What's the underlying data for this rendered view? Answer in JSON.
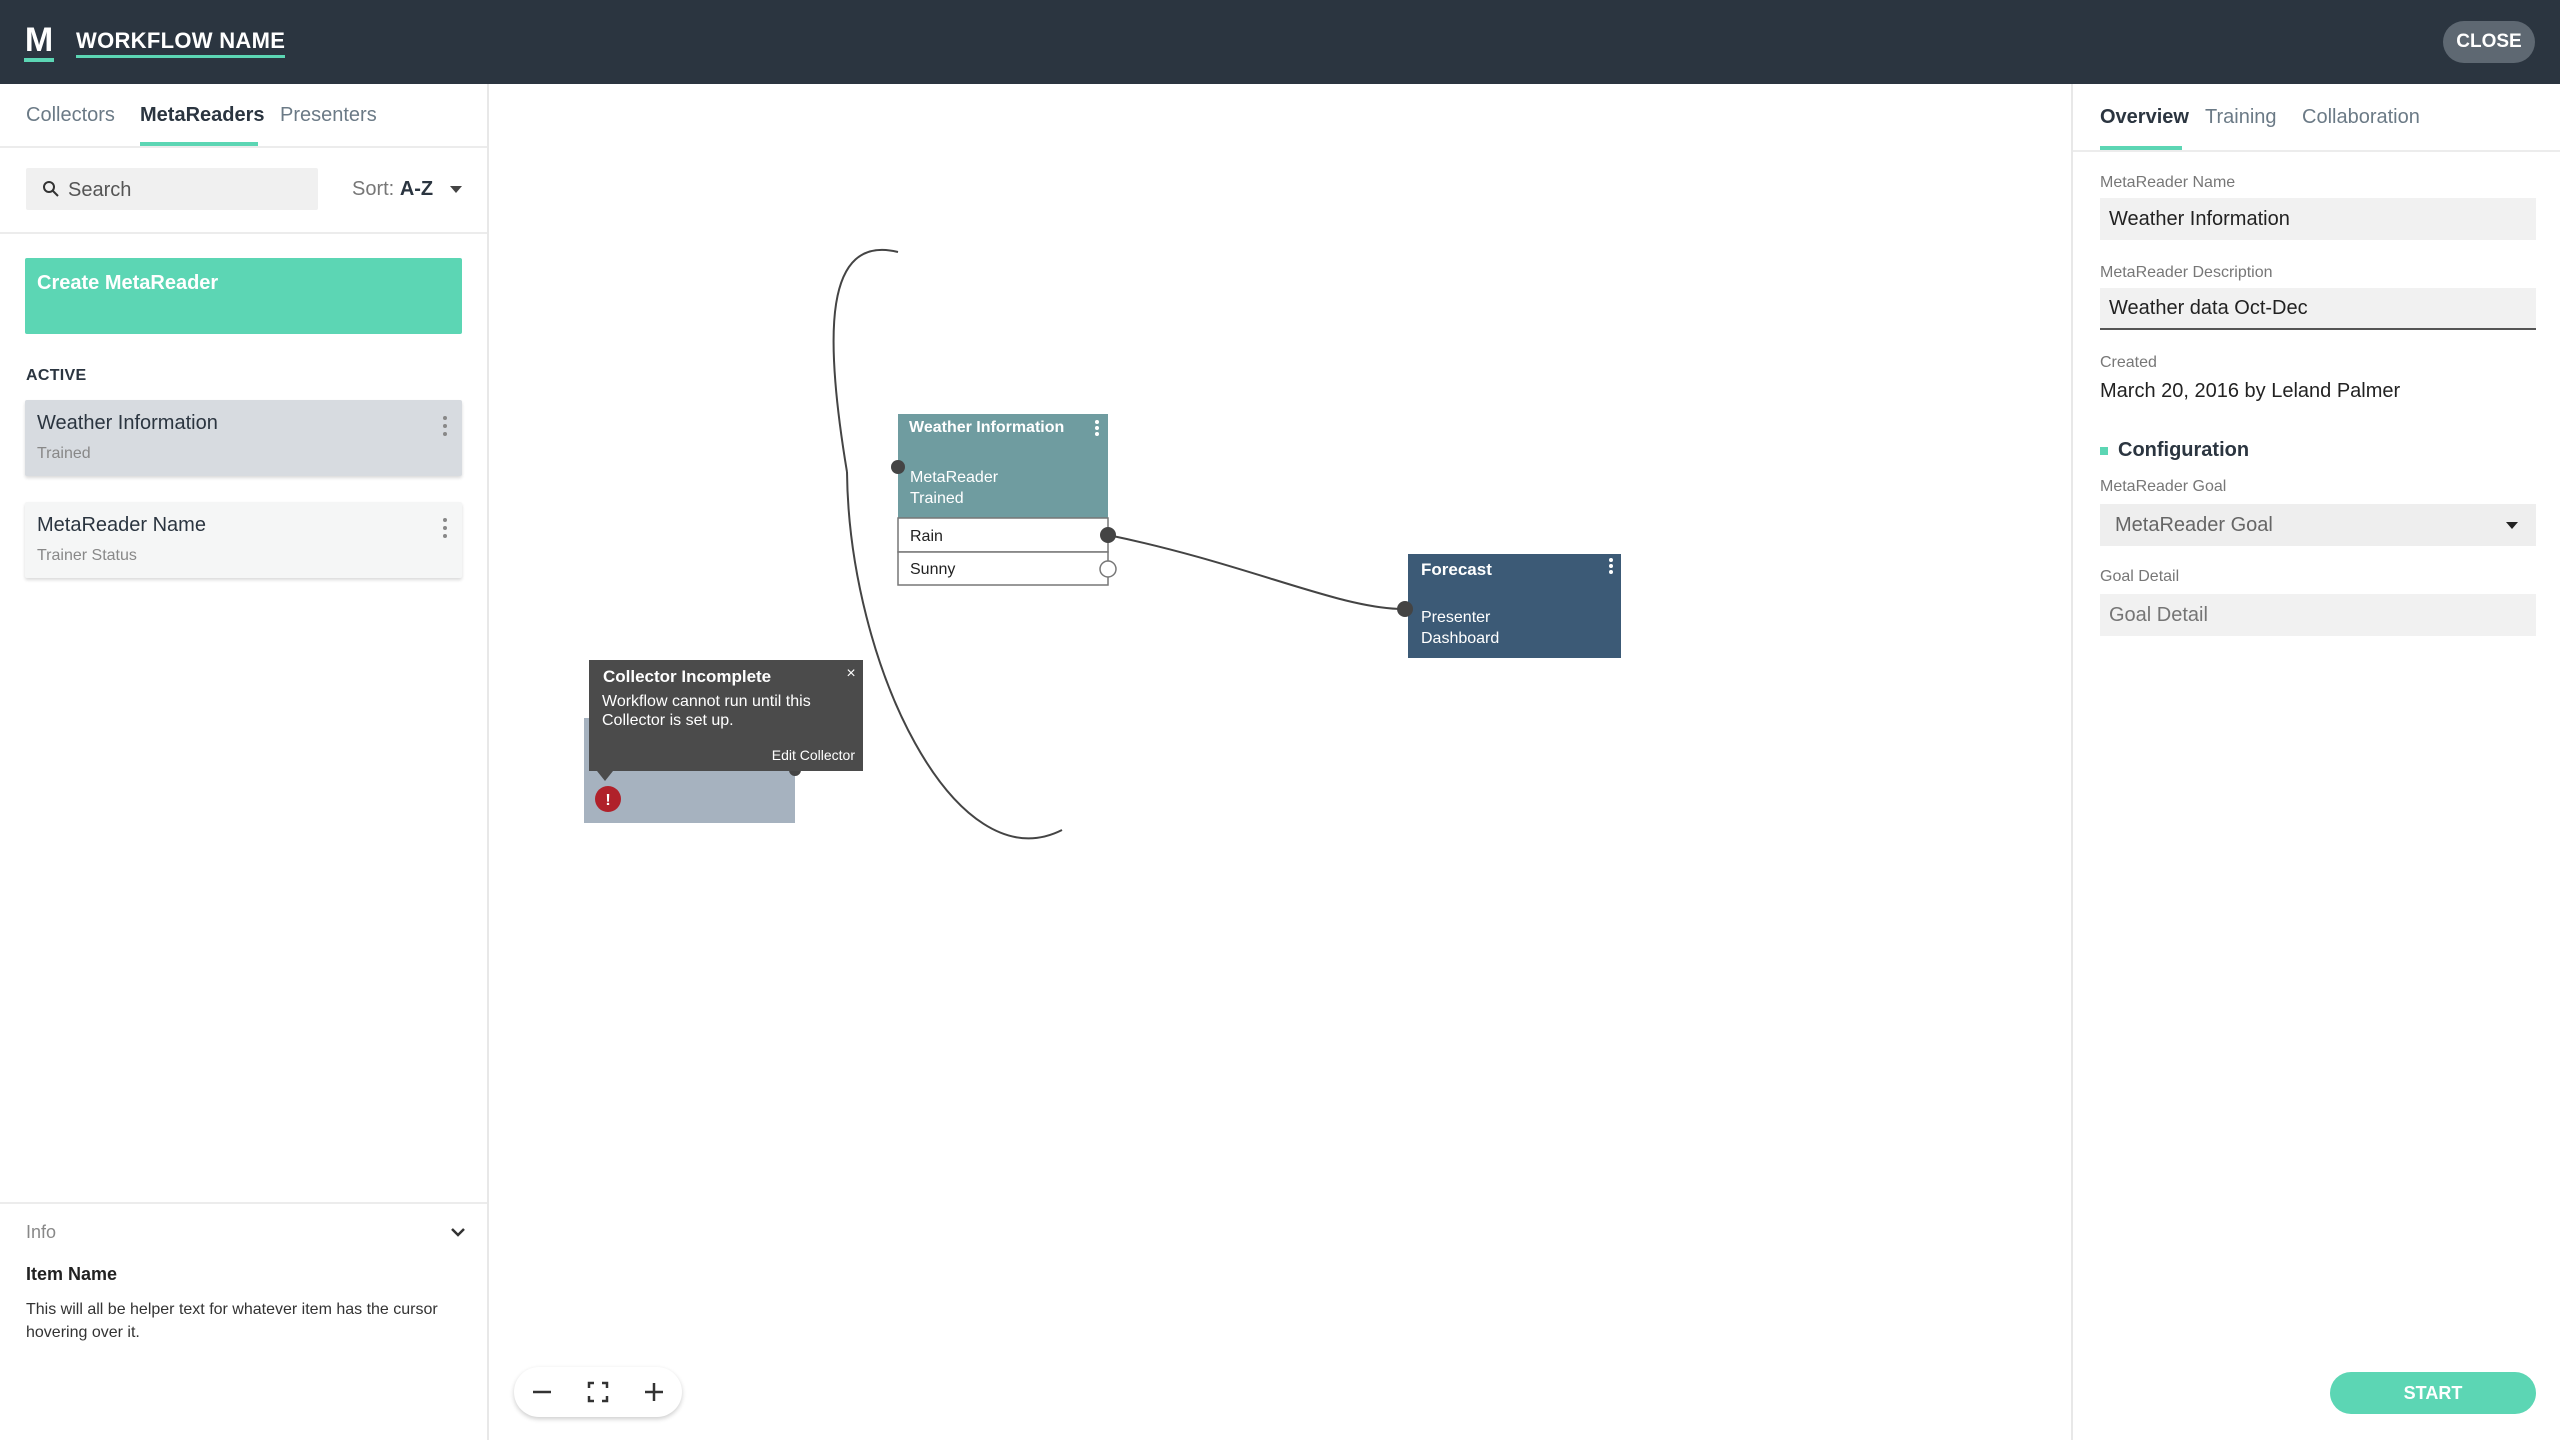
{
  "header": {
    "logo_letter": "M",
    "workflow_name": "WORKFLOW NAME",
    "close_label": "CLOSE"
  },
  "left": {
    "tabs": [
      {
        "label": "Collectors"
      },
      {
        "label": "MetaReaders"
      },
      {
        "label": "Presenters"
      }
    ],
    "search_placeholder": "Search",
    "sort_label": "Sort:",
    "sort_value": "A-Z",
    "create_label": "Create MetaReader",
    "section_label": "ACTIVE",
    "items": [
      {
        "title": "Weather Information",
        "status": "Trained"
      },
      {
        "title": "MetaReader Name",
        "status": "Trainer Status"
      }
    ],
    "info": {
      "label": "Info",
      "title": "Item Name",
      "text": "This will all be helper text for whatever item has the cursor hovering over it."
    }
  },
  "canvas": {
    "metareader_node": {
      "title": "Weather Information",
      "type": "MetaReader",
      "status": "Trained",
      "outputs": [
        "Rain",
        "Sunny"
      ]
    },
    "presenter_node": {
      "title": "Forecast",
      "type": "Presenter",
      "subtype": "Dashboard"
    },
    "tooltip": {
      "title": "Collector Incomplete",
      "message": "Workflow cannot run until this Collector is set up.",
      "action": "Edit Collector",
      "close": "×"
    },
    "error_mark": "!",
    "colors": {
      "metareader": "#6f9ca0",
      "presenter": "#3c5a76",
      "collector": "#a6b2bf",
      "tooltip": "#4b4b4b",
      "error": "#b0212a"
    }
  },
  "right": {
    "tabs": [
      {
        "label": "Overview"
      },
      {
        "label": "Training"
      },
      {
        "label": "Collaboration"
      }
    ],
    "name_label": "MetaReader Name",
    "name_value": "Weather Information",
    "desc_label": "MetaReader Description",
    "desc_value": "Weather data Oct-Dec",
    "created_label": "Created",
    "created_value": "March 20, 2016 by Leland Palmer",
    "config_label": "Configuration",
    "goal_label": "MetaReader Goal",
    "goal_value": "MetaReader Goal",
    "detail_label": "Goal Detail",
    "detail_placeholder": "Goal Detail",
    "start_label": "START"
  },
  "accent": "#5cd6b4"
}
